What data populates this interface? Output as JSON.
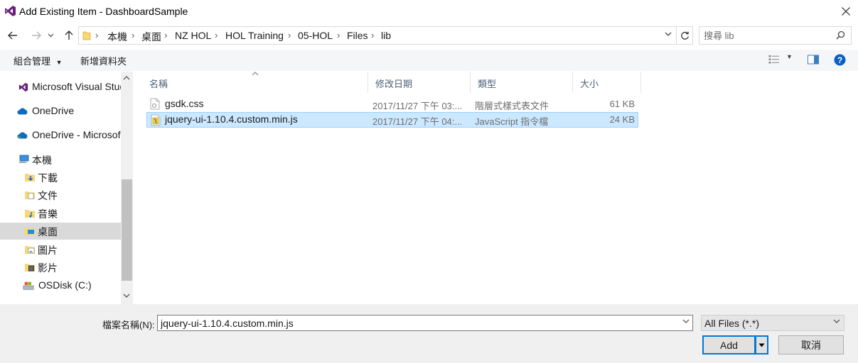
{
  "window": {
    "title": "Add Existing Item - DashboardSample"
  },
  "address": {
    "crumbs": [
      "本機",
      "桌面",
      "NZ HOL",
      "HOL Training",
      "05-HOL",
      "Files",
      "lib"
    ]
  },
  "search": {
    "placeholder": "搜尋 lib"
  },
  "toolbar": {
    "organize_label": "組合管理",
    "new_folder_label": "新增資料夾"
  },
  "sidebar": {
    "items": [
      {
        "label": "Microsoft Visual Studio",
        "icon": "visual-studio-icon"
      },
      {
        "label": "OneDrive",
        "icon": "cloud-icon"
      },
      {
        "label": "OneDrive - Microsoft",
        "icon": "cloud-icon"
      },
      {
        "label": "本機",
        "icon": "computer-icon"
      },
      {
        "label": "下載",
        "icon": "download-folder-icon"
      },
      {
        "label": "文件",
        "icon": "documents-folder-icon"
      },
      {
        "label": "音樂",
        "icon": "music-folder-icon"
      },
      {
        "label": "桌面",
        "icon": "desktop-folder-icon",
        "selected": true
      },
      {
        "label": "圖片",
        "icon": "pictures-folder-icon"
      },
      {
        "label": "影片",
        "icon": "videos-folder-icon"
      },
      {
        "label": "OSDisk (C:)",
        "icon": "drive-icon"
      }
    ]
  },
  "files": {
    "columns": [
      "名稱",
      "修改日期",
      "類型",
      "大小"
    ],
    "rows": [
      {
        "name": "gsdk.css",
        "modified": "2017/11/27 下午 03:...",
        "type": "階層式樣式表文件",
        "size": "61 KB",
        "icon": "css-file-icon"
      },
      {
        "name": "jquery-ui-1.10.4.custom.min.js",
        "modified": "2017/11/27 下午 04:...",
        "type": "JavaScript 指令檔",
        "size": "24 KB",
        "icon": "js-file-icon",
        "selected": true
      }
    ]
  },
  "footer": {
    "filename_label": "檔案名稱(N):",
    "filename_value": "jquery-ui-1.10.4.custom.min.js",
    "filter_value": "All Files (*.*)",
    "add_label": "Add",
    "cancel_label": "取消"
  },
  "colors": {
    "accent": "#0078d7",
    "selection": "#cce8ff",
    "vs_purple": "#68217a"
  }
}
